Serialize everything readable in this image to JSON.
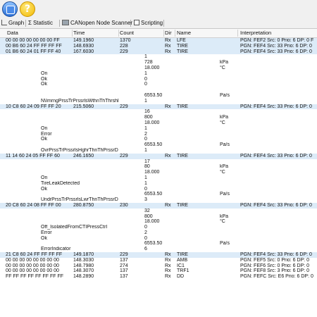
{
  "toolbar": {
    "icons": [
      "window-icon",
      "help-icon"
    ],
    "help_glyph": "?"
  },
  "tabs": [
    {
      "label": "Graph",
      "icon": "graph-icon"
    },
    {
      "label": "Statistic",
      "icon": "sigma-icon",
      "glyph": "Σ"
    },
    {
      "label": "CANopen Node Scanner",
      "icon": "scanner-icon"
    },
    {
      "label": "Scripting",
      "icon": "script-icon"
    }
  ],
  "columns": [
    "Data",
    "Time",
    "Count",
    "Dir",
    "Name",
    "Interpretation"
  ],
  "rows": [
    {
      "type": "msg",
      "hl": true,
      "data": "00 00 00 00 00 00 00 FF",
      "time": "149.1960",
      "count": "1370",
      "dir": "Rx",
      "name": "LFE",
      "interp": "PGN: FEF2 Src: 0 Prio: 6 DP: 0 F"
    },
    {
      "type": "msg",
      "hl": true,
      "data": "00 B6 60 24 FF FF FF FF",
      "time": "148.6930",
      "count": "228",
      "dir": "Rx",
      "name": "TIRE",
      "interp": "PGN: FEF4 Src: 33 Prio: 6 DP: 0"
    },
    {
      "type": "msg",
      "hl": true,
      "data": "01 B6 60 24 01 FF FF 40",
      "time": "167.6030",
      "count": "229",
      "dir": "Rx",
      "name": "TIRE",
      "interp": "PGN: FEF4 Src: 33 Prio: 6 DP: 0"
    },
    {
      "type": "sig",
      "label": "",
      "value": "1",
      "unit": ""
    },
    {
      "type": "sig",
      "label": "",
      "value": "728",
      "unit": "kPa"
    },
    {
      "type": "sig",
      "label": "",
      "value": "18.000",
      "unit": "°C"
    },
    {
      "type": "sig",
      "label": "On",
      "value": "1",
      "unit": ""
    },
    {
      "type": "sig",
      "label": "Ok",
      "value": "0",
      "unit": ""
    },
    {
      "type": "sig",
      "label": "Ok",
      "value": "0",
      "unit": ""
    },
    {
      "type": "sig",
      "label": "",
      "value": "",
      "unit": ""
    },
    {
      "type": "sig",
      "label": "",
      "value": "6553.50",
      "unit": "Pa/s"
    },
    {
      "type": "sig",
      "label": "N\\ImrngPrssTrPrssrlsWthnThThrshl",
      "value": "1",
      "unit": ""
    },
    {
      "type": "msg",
      "hl": true,
      "data": "10 C8 60 24 09 FF FF 20",
      "time": "215.5060",
      "count": "229",
      "dir": "Rx",
      "name": "TIRE",
      "interp": "PGN: FEF4 Src: 33 Prio: 6 DP: 0"
    },
    {
      "type": "sig",
      "label": "",
      "value": "16",
      "unit": ""
    },
    {
      "type": "sig",
      "label": "",
      "value": "800",
      "unit": "kPa"
    },
    {
      "type": "sig",
      "label": "",
      "value": "18.000",
      "unit": "°C"
    },
    {
      "type": "sig",
      "label": "On",
      "value": "1",
      "unit": ""
    },
    {
      "type": "sig",
      "label": "Error",
      "value": "2",
      "unit": ""
    },
    {
      "type": "sig",
      "label": "Ok",
      "value": "0",
      "unit": ""
    },
    {
      "type": "sig",
      "label": "",
      "value": "6553.50",
      "unit": "Pa/s"
    },
    {
      "type": "sig",
      "label": "OvrPrssTrPrssrlsHghrThnThPrssrD",
      "value": "1",
      "unit": ""
    },
    {
      "type": "msg",
      "hl": true,
      "data": "11 14 60 24 05 FF FF 60",
      "time": "246.1650",
      "count": "229",
      "dir": "Rx",
      "name": "TIRE",
      "interp": "PGN: FEF4 Src: 33 Prio: 6 DP: 0"
    },
    {
      "type": "sig",
      "label": "",
      "value": "17",
      "unit": ""
    },
    {
      "type": "sig",
      "label": "",
      "value": "80",
      "unit": "kPa"
    },
    {
      "type": "sig",
      "label": "",
      "value": "18.000",
      "unit": "°C"
    },
    {
      "type": "sig",
      "label": "On",
      "value": "1",
      "unit": ""
    },
    {
      "type": "sig",
      "label": "TireLeakDetected",
      "value": "1",
      "unit": ""
    },
    {
      "type": "sig",
      "label": "Ok",
      "value": "0",
      "unit": ""
    },
    {
      "type": "sig",
      "label": "",
      "value": "6553.50",
      "unit": "Pa/s"
    },
    {
      "type": "sig",
      "label": "UndrPrssTrPrssrlsLwrThnThPrssrD",
      "value": "3",
      "unit": ""
    },
    {
      "type": "msg",
      "hl": true,
      "data": "20 C8 60 24 08 FF FF 00",
      "time": "280.8750",
      "count": "230",
      "dir": "Rx",
      "name": "TIRE",
      "interp": "PGN: FEF4 Src: 33 Prio: 6 DP: 0"
    },
    {
      "type": "sig",
      "label": "",
      "value": "32",
      "unit": ""
    },
    {
      "type": "sig",
      "label": "",
      "value": "800",
      "unit": "kPa"
    },
    {
      "type": "sig",
      "label": "",
      "value": "18.000",
      "unit": "°C"
    },
    {
      "type": "sig",
      "label": "Off_IsolatedFromCTIPressCtrl",
      "value": "0",
      "unit": ""
    },
    {
      "type": "sig",
      "label": "Error",
      "value": "2",
      "unit": ""
    },
    {
      "type": "sig",
      "label": "Ok",
      "value": "0",
      "unit": ""
    },
    {
      "type": "sig",
      "label": "",
      "value": "6553.50",
      "unit": "Pa/s"
    },
    {
      "type": "sig",
      "label": "ErrorIndicator",
      "value": "6",
      "unit": ""
    },
    {
      "type": "msg",
      "hl": true,
      "data": "21 C8 60 24 FF FF FF FF",
      "time": "149.1870",
      "count": "229",
      "dir": "Rx",
      "name": "TIRE",
      "interp": "PGN: FEF4 Src: 33 Prio: 6 DP: 0"
    },
    {
      "type": "msg",
      "hl": false,
      "data": "00 00 00 00 00 00 00 00",
      "time": "148.3030",
      "count": "137",
      "dir": "Rx",
      "name": "AMB",
      "interp": "PGN: FEF5 Src: 0 Prio: 6 DP: 0"
    },
    {
      "type": "msg",
      "hl": false,
      "data": "00 00 00 00 00 00 00 00",
      "time": "148.7980",
      "count": "274",
      "dir": "Rx",
      "name": "IC1",
      "interp": "PGN: FEF6 Src: 0 Prio: 6 DP: 0"
    },
    {
      "type": "msg",
      "hl": false,
      "data": "00 00 00 00 00 00 00 00",
      "time": "148.3070",
      "count": "137",
      "dir": "Rx",
      "name": "TRF1",
      "interp": "PGN: FEF8 Src: 3 Prio: 6 DP: 0"
    },
    {
      "type": "msg",
      "hl": false,
      "data": "FF FF FF FF FF FF FF FF",
      "time": "148.2890",
      "count": "137",
      "dir": "Rx",
      "name": "DD",
      "interp": "PGN: FEFC Src: E6 Prio: 6 DP: 0"
    }
  ]
}
